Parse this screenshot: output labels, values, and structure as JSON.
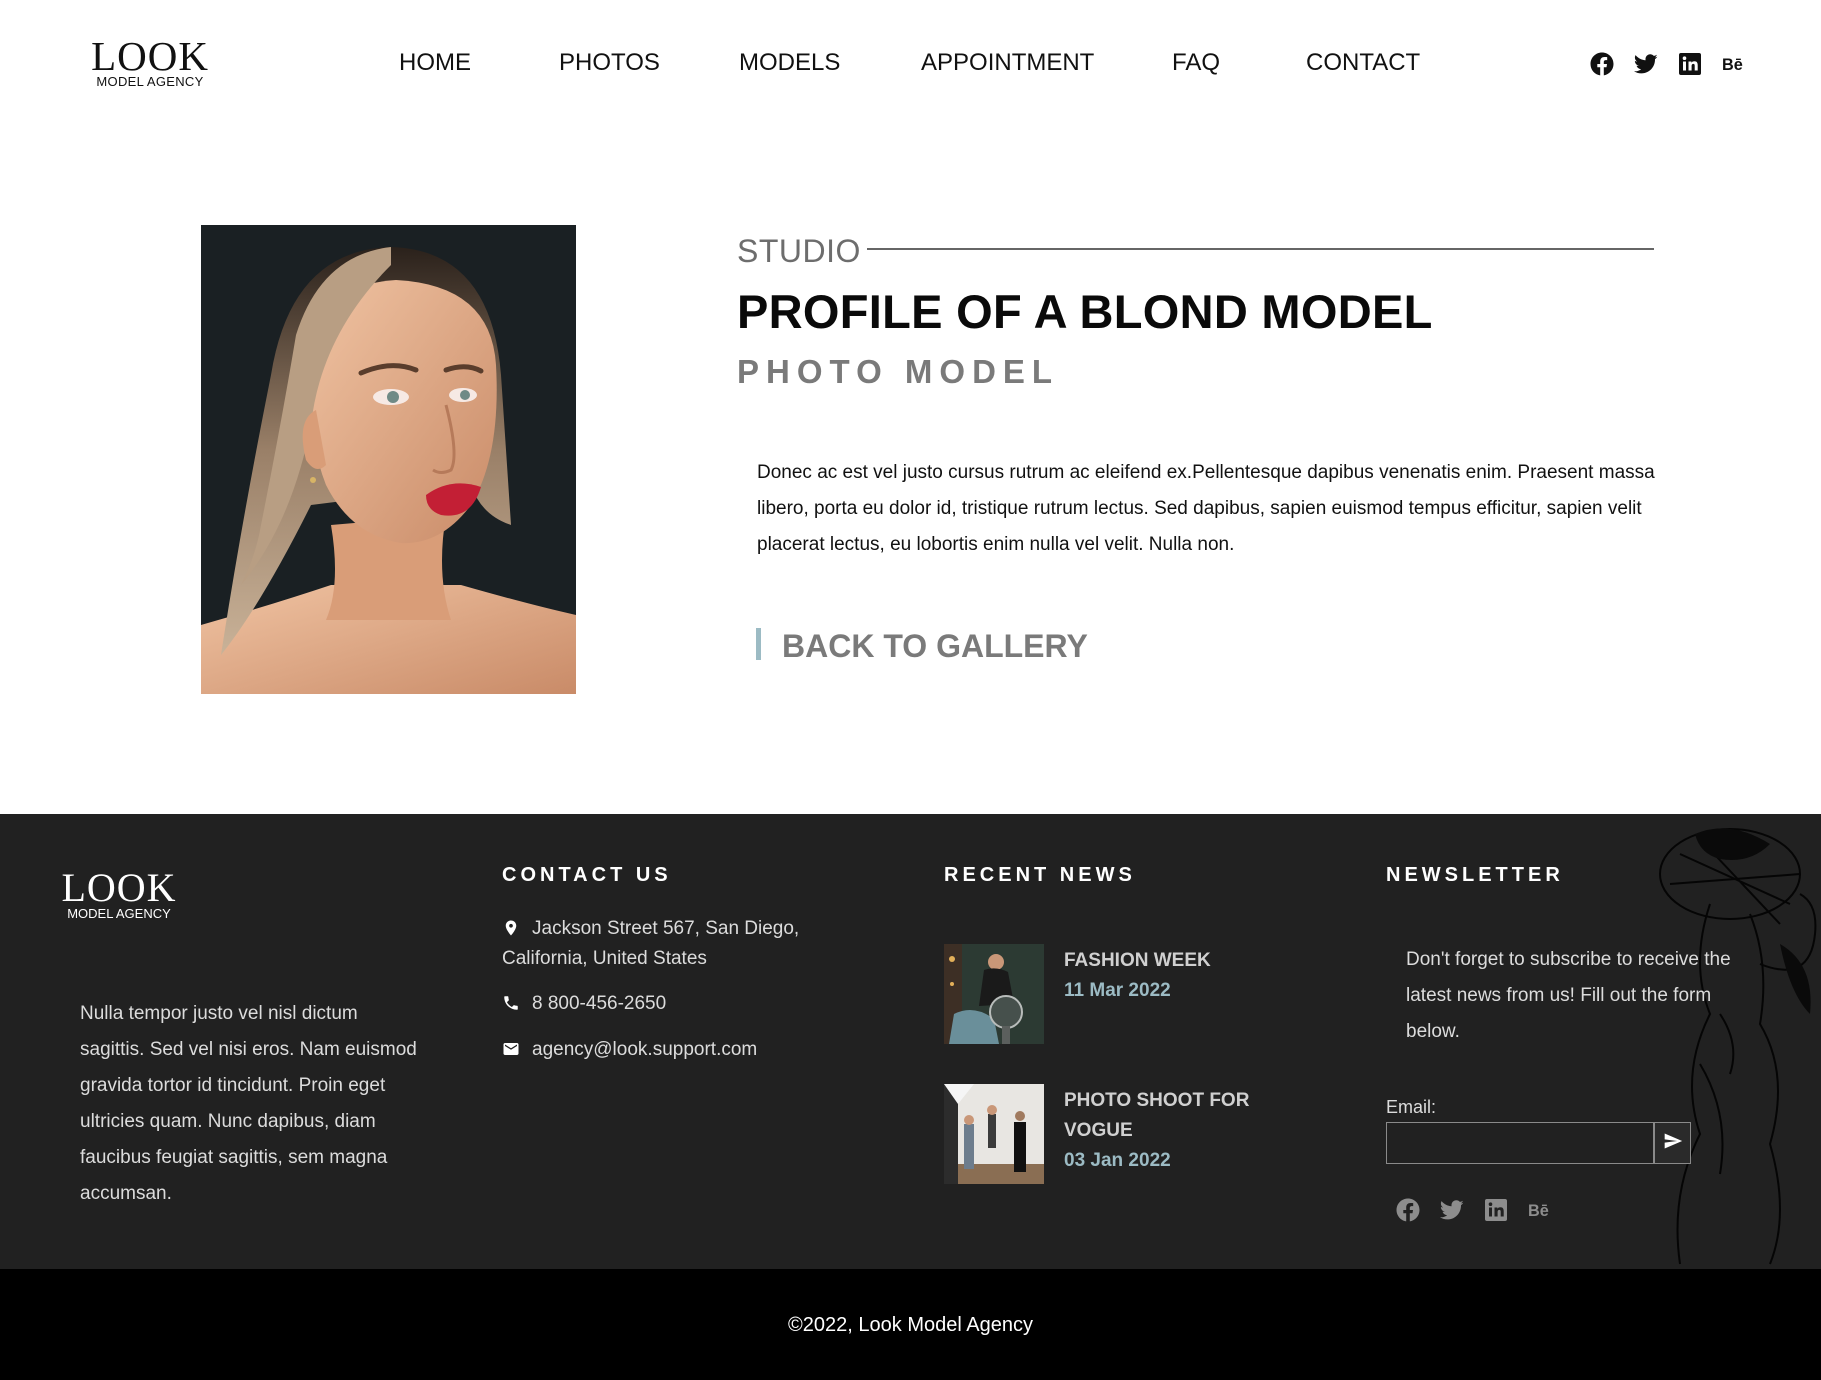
{
  "header": {
    "logo": {
      "word": "LOOK",
      "sub": "MODEL AGENCY"
    },
    "nav": [
      "HOME",
      "PHOTOS",
      "MODELS",
      "APPOINTMENT",
      "FAQ",
      "CONTACT"
    ],
    "socials": [
      "facebook-icon",
      "twitter-icon",
      "linkedin-icon",
      "behance-icon"
    ]
  },
  "profile": {
    "category": "STUDIO",
    "title": "PROFILE OF A BLOND MODEL",
    "subtitle": "PHOTO MODEL",
    "description": "Donec ac est vel justo cursus rutrum ac eleifend ex.Pellentesque dapibus venenatis enim. Praesent massa libero, porta eu dolor id, tristique rutrum lectus. Sed dapibus, sapien euismod tempus efficitur, sapien velit placerat lectus, eu lobortis enim nulla vel velit. Nulla non.",
    "back_label": "BACK TO GALLERY"
  },
  "footer": {
    "logo": {
      "word": "LOOK",
      "sub": "MODEL AGENCY"
    },
    "about": "Nulla tempor justo vel nisl dictum sagittis. Sed vel nisi eros. Nam euismod gravida tortor id tincidunt. Proin eget ultricies quam. Nunc dapibus, diam faucibus feugiat sagittis, sem magna accumsan.",
    "contact": {
      "heading": "CONTACT US",
      "address_line1": "Jackson Street 567, San Diego,",
      "address_line2": "California, United States",
      "phone": "8 800-456-2650",
      "email": "agency@look.support.com"
    },
    "news": {
      "heading": "RECENT NEWS",
      "items": [
        {
          "title": "FASHION WEEK",
          "date": "11 Mar 2022"
        },
        {
          "title": "PHOTO SHOOT FOR VOGUE",
          "date": "03 Jan 2022"
        }
      ]
    },
    "newsletter": {
      "heading": "NEWSLETTER",
      "text": "Don't forget to subscribe to receive the latest news from us! Fill out the form below.",
      "email_label": "Email:",
      "email_value": ""
    }
  },
  "copyright": "©2022, Look Model Agency",
  "colors": {
    "accent": "#9cbbc4",
    "footer_bg": "#212121",
    "copyright_bg": "#000000",
    "muted_text": "#7a7a7a"
  }
}
